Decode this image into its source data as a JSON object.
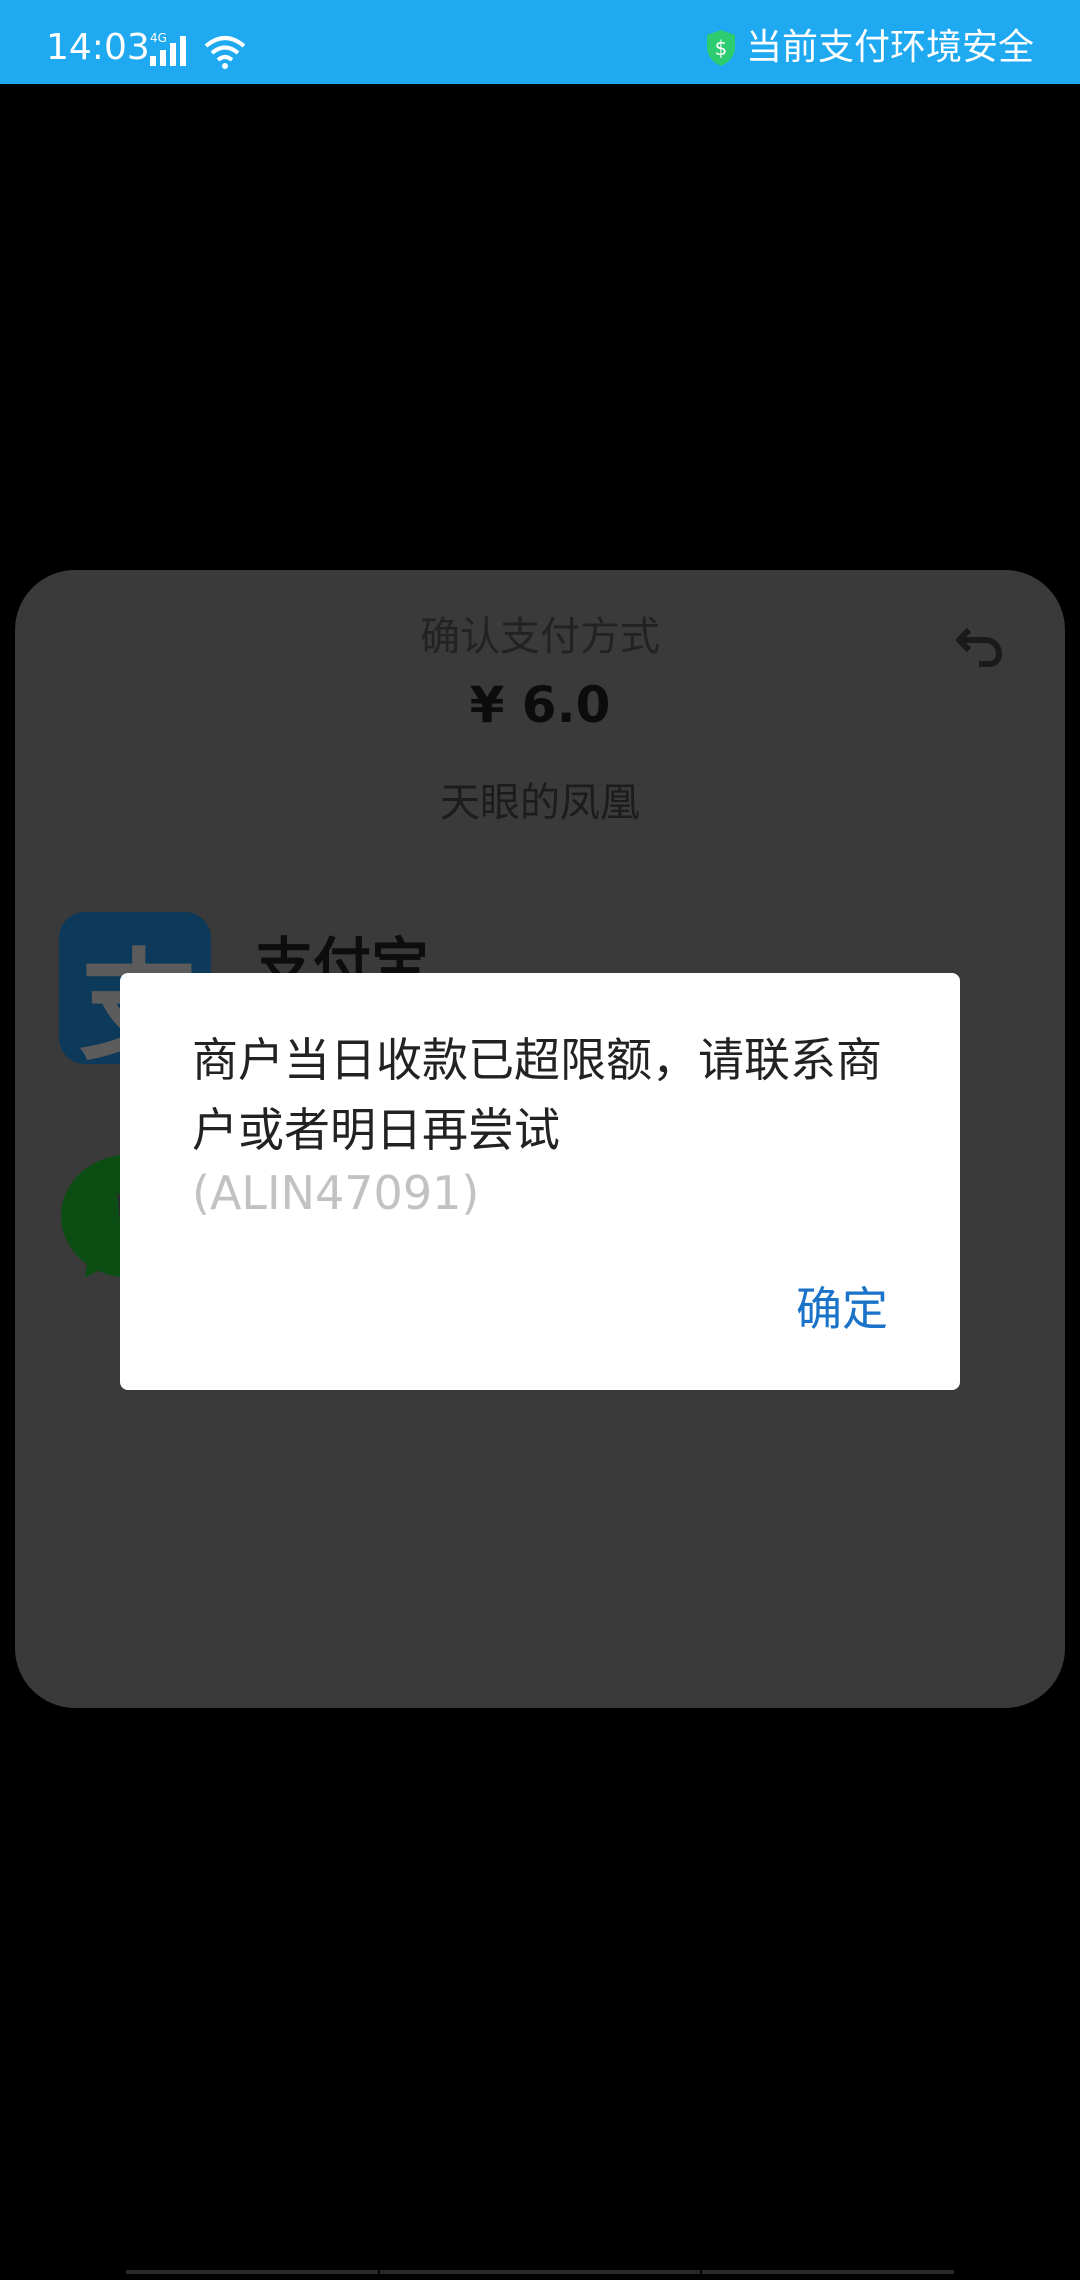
{
  "status_bar": {
    "time": "14:03",
    "network_label": "4G",
    "secure_text": "当前支付环境安全",
    "icons": [
      "signal-icon",
      "wifi-icon",
      "shield-icon"
    ],
    "background": "#1ea9f0"
  },
  "sheet": {
    "title": "确认支付方式",
    "amount": "¥ 6.0",
    "merchant": "天眼的凤凰",
    "methods": [
      {
        "name": "支付宝",
        "icon": "alipay-icon"
      },
      {
        "name": "",
        "icon": "wechat-icon"
      }
    ],
    "back_icon": "back-arrow-icon"
  },
  "dialog": {
    "message": "商户当日收款已超限额，请联系商户或者明日再尝试",
    "code": "(ALIN47091)",
    "ok_label": "确定",
    "ok_color": "#1a73c8"
  }
}
